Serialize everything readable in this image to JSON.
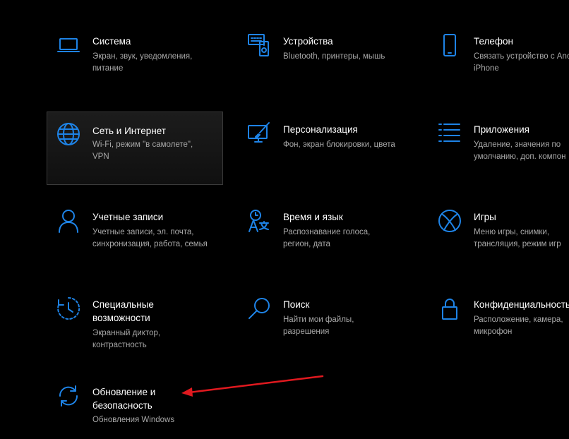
{
  "tiles": [
    {
      "id": "system",
      "icon": "laptop-icon",
      "title": "Система",
      "desc": "Экран, звук, уведомления,\nпитание"
    },
    {
      "id": "devices",
      "icon": "devices-icon",
      "title": "Устройства",
      "desc": "Bluetooth, принтеры, мышь"
    },
    {
      "id": "phone",
      "icon": "phone-icon",
      "title": "Телефон",
      "desc": "Связать устройство с Anc\niPhone"
    },
    {
      "id": "network",
      "icon": "globe-icon",
      "title": "Сеть и Интернет",
      "desc": "Wi-Fi, режим \"в самолете\",\nVPN"
    },
    {
      "id": "personalization",
      "icon": "personalization-icon",
      "title": "Персонализация",
      "desc": "Фон, экран блокировки, цвета"
    },
    {
      "id": "apps",
      "icon": "apps-list-icon",
      "title": "Приложения",
      "desc": "Удаление, значения по\nумолчанию, доп. компон"
    },
    {
      "id": "accounts",
      "icon": "person-icon",
      "title": "Учетные записи",
      "desc": "Учетные записи, эл. почта,\nсинхронизация, работа, семья"
    },
    {
      "id": "time-language",
      "icon": "time-language-icon",
      "title": "Время и язык",
      "desc": "Распознавание голоса,\nрегион, дата"
    },
    {
      "id": "gaming",
      "icon": "xbox-icon",
      "title": "Игры",
      "desc": "Меню игры, снимки,\nтрансляция, режим игр"
    },
    {
      "id": "ease-of-access",
      "icon": "ease-of-access-icon",
      "title": "Специальные\nвозможности",
      "desc": "Экранный диктор,\nконтрастность"
    },
    {
      "id": "search",
      "icon": "search-icon",
      "title": "Поиск",
      "desc": "Найти мои файлы,\nразрешения"
    },
    {
      "id": "privacy",
      "icon": "lock-icon",
      "title": "Конфиденциальность",
      "desc": "Расположение, камера,\nмикрофон"
    },
    {
      "id": "update-security",
      "icon": "sync-icon",
      "title": "Обновление и\nбезопасность",
      "desc": "Обновления Windows"
    }
  ],
  "colors": {
    "accent": "#1e83e6",
    "arrow": "#e0191f",
    "desc": "#a8a8a8"
  }
}
